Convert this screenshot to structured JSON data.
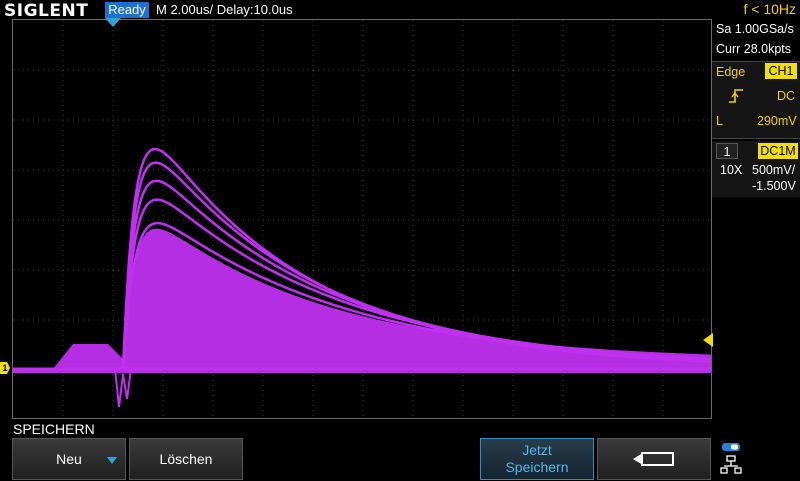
{
  "header": {
    "logo": "SIGLENT",
    "status": "Ready",
    "timebase": "M 2.00us/  Delay:10.0us",
    "frequency": "f < 10Hz"
  },
  "acquisition": {
    "sample_rate": "Sa 1.00GSa/s",
    "memory": "Curr 28.0kpts"
  },
  "trigger": {
    "type": "Edge",
    "source": "CH1",
    "slope_icon": "rising-edge-icon",
    "coupling": "DC",
    "level_label": "L",
    "level_value": "290mV"
  },
  "channel": {
    "number": "1",
    "coupling": "DC1M",
    "probe": "10X",
    "volts_per_div": "500mV/",
    "offset": "-1.500V",
    "marker_label": "1"
  },
  "menu": {
    "title": "SPEICHERN",
    "buttons": {
      "neu": "Neu",
      "loeschen": "Löschen",
      "jetzt_line1": "Jetzt",
      "jetzt_line2": "Speichern"
    }
  },
  "colors": {
    "waveform": "#c030f0",
    "accent_yellow": "#f4e000",
    "accent_blue": "#2aa7d8"
  }
}
